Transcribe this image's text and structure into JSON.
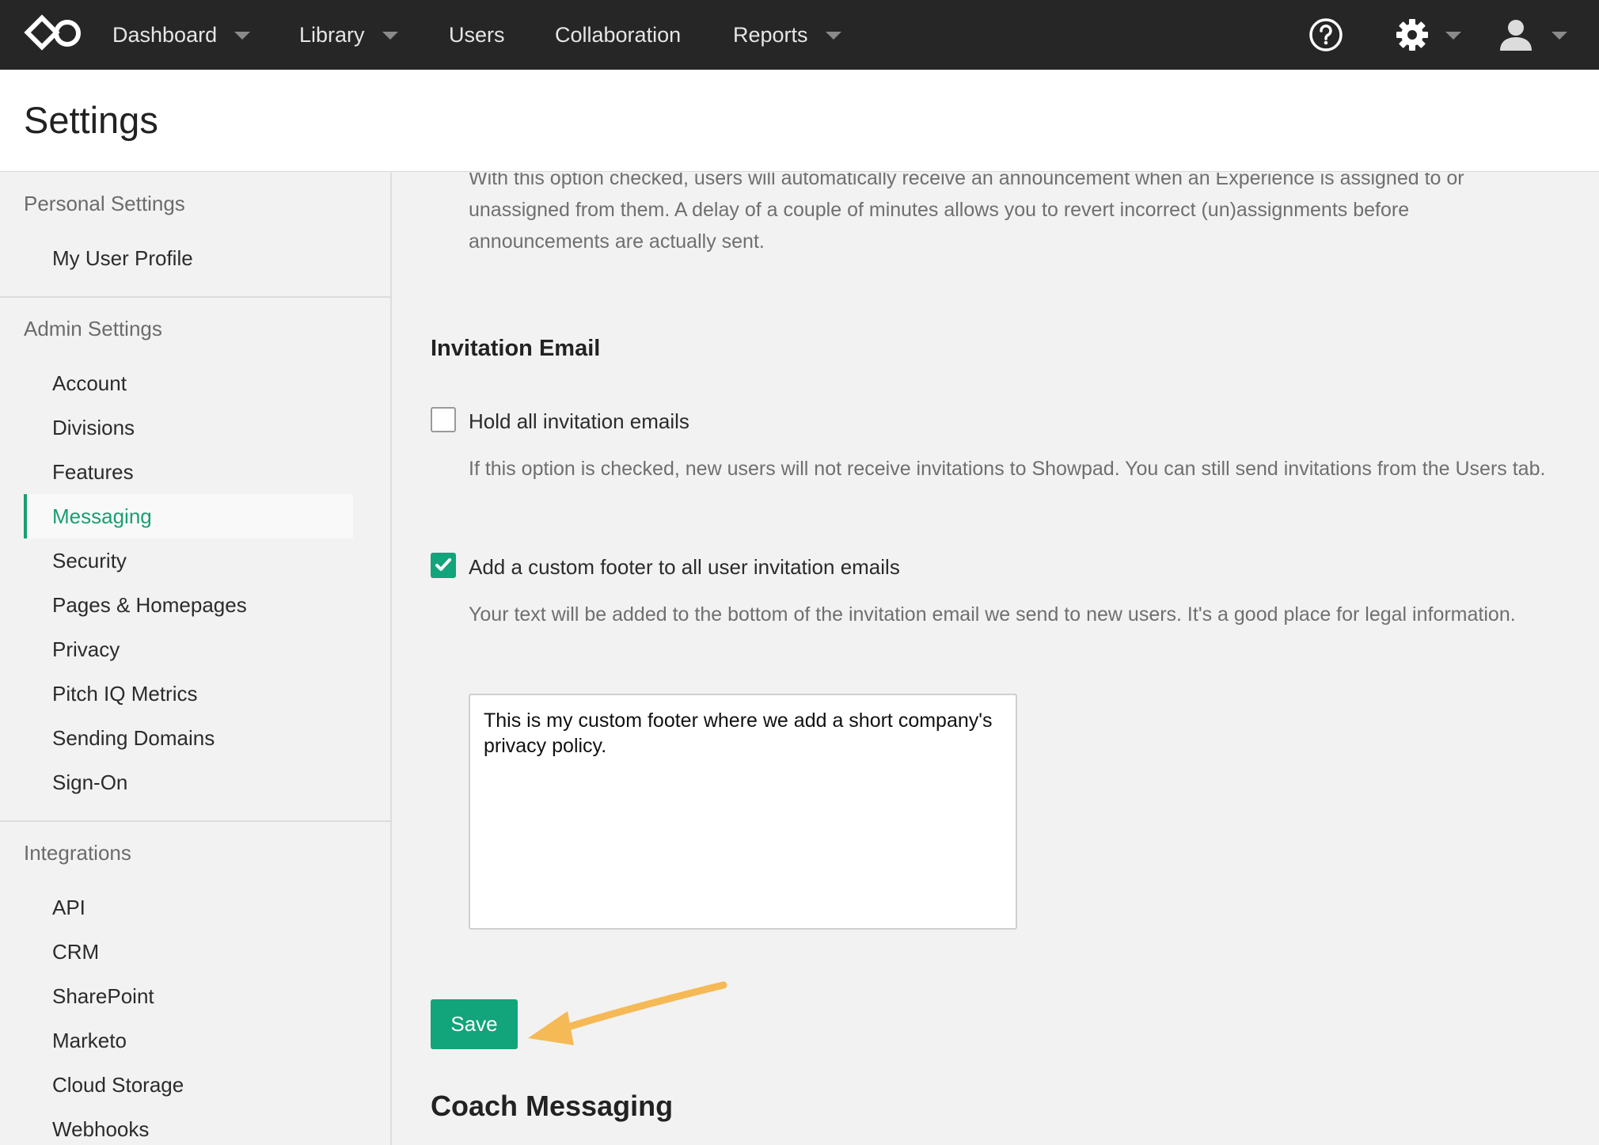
{
  "colors": {
    "nav_bg": "#262626",
    "accent": "#12a47a",
    "arrow": "#f5b955",
    "page_bg": "#f2f2f2"
  },
  "nav": {
    "items": [
      {
        "label": "Dashboard",
        "has_caret": true
      },
      {
        "label": "Library",
        "has_caret": true
      },
      {
        "label": "Users",
        "has_caret": false
      },
      {
        "label": "Collaboration",
        "has_caret": false
      },
      {
        "label": "Reports",
        "has_caret": true
      }
    ],
    "icons": [
      "logo-icon",
      "help-icon",
      "gear-icon",
      "user-icon"
    ]
  },
  "page": {
    "title": "Settings"
  },
  "sidebar": {
    "groups": [
      {
        "title": "Personal Settings",
        "items": [
          "My User Profile"
        ]
      },
      {
        "title": "Admin Settings",
        "items": [
          "Account",
          "Divisions",
          "Features",
          "Messaging",
          "Security",
          "Pages & Homepages",
          "Privacy",
          "Pitch IQ Metrics",
          "Sending Domains",
          "Sign-On"
        ]
      },
      {
        "title": "Integrations",
        "items": [
          "API",
          "CRM",
          "SharePoint",
          "Marketo",
          "Cloud Storage",
          "Webhooks"
        ]
      }
    ],
    "active_item": "Messaging"
  },
  "main": {
    "intro_desc": "With this option checked, users will automatically receive an announcement when an Experience is assigned to or unassigned from them. A delay of a couple of minutes allows you to revert incorrect (un)assignments before announcements are actually sent.",
    "invitation": {
      "title": "Invitation Email",
      "hold": {
        "label": "Hold all invitation emails",
        "checked": false,
        "desc": "If this option is checked, new users will not receive invitations to Showpad. You can still send invitations from the Users tab."
      },
      "footer": {
        "label": "Add a custom footer to all user invitation emails",
        "checked": true,
        "desc": "Your text will be added to the bottom of the invitation email we send to new users. It's a good place for legal information.",
        "value": "This is my custom footer where we add a short company's privacy policy."
      }
    },
    "save_label": "Save",
    "coach_title": "Coach Messaging"
  }
}
